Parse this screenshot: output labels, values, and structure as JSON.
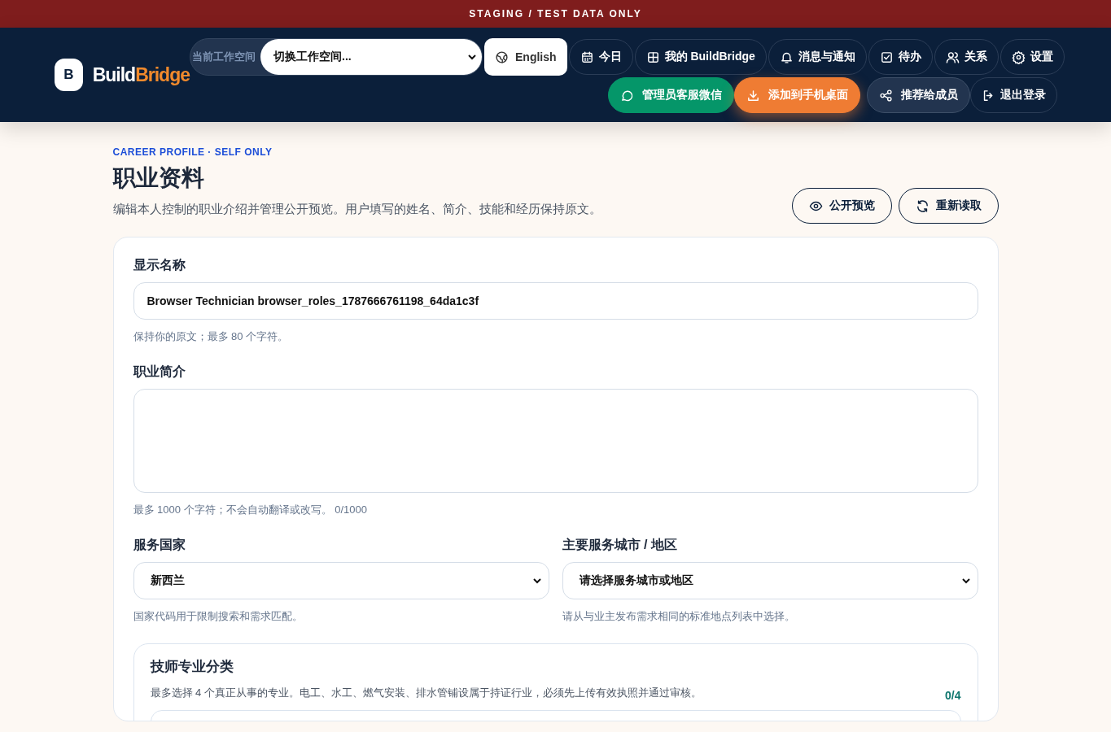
{
  "banner": "STAGING / TEST DATA ONLY",
  "brand": {
    "mark": "B",
    "name_a": "Build",
    "name_b": "Bridge"
  },
  "workspace": {
    "label": "当前工作空间",
    "value": "切换工作空间..."
  },
  "language": "English",
  "nav_top": [
    {
      "label": "今日"
    },
    {
      "label": "我的 BuildBridge"
    },
    {
      "label": "消息与通知"
    },
    {
      "label": "待办"
    },
    {
      "label": "关系"
    },
    {
      "label": "设置"
    }
  ],
  "nav_bottom": [
    {
      "label": "管理员客服微信",
      "kind": "success"
    },
    {
      "label": "添加到手机桌面",
      "kind": "accent"
    },
    {
      "label": "推荐给成员",
      "kind": "muted"
    },
    {
      "label": "退出登录",
      "kind": "plain"
    }
  ],
  "page": {
    "eyebrow": "CAREER PROFILE · SELF ONLY",
    "title": "职业资料",
    "subtitle": "编辑本人控制的职业介绍并管理公开预览。用户填写的姓名、简介、技能和经历保持原文。",
    "actions": [
      "公开预览",
      "重新读取"
    ]
  },
  "form": {
    "display_name": {
      "label": "显示名称",
      "value": "Browser Technician browser_roles_1787666761198_64da1c3f",
      "help": "保持你的原文；最多 80 个字符。"
    },
    "bio": {
      "label": "职业简介",
      "help": "最多 1000 个字符；不会自动翻译或改写。 0/1000"
    },
    "country": {
      "label": "服务国家",
      "value": "新西兰",
      "help": "国家代码用于限制搜索和需求匹配。"
    },
    "city": {
      "label": "主要服务城市 / 地区",
      "value": "请选择服务城市或地区",
      "help": "请从与业主发布需求相同的标准地点列表中选择。"
    },
    "trades": {
      "title": "技师专业分类",
      "help": "最多选择 4 个真正从事的专业。电工、水工、燃气安装、排水管铺设属于持证行业，必须先上传有效执照并通过审核。",
      "count": "0/4"
    }
  }
}
